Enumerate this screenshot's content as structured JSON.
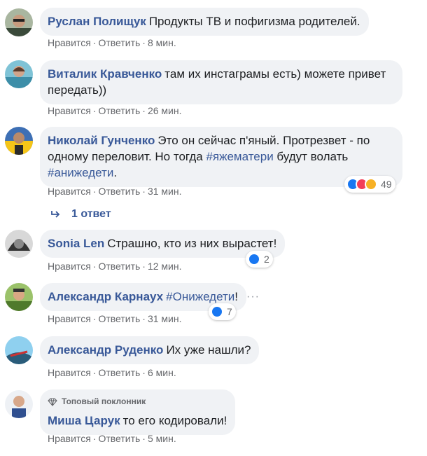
{
  "actions": {
    "like": "Нравится",
    "reply": "Ответить",
    "sep": "·"
  },
  "comments": [
    {
      "author": "Руслан Полищук",
      "text": "Продукты ТВ и пофигизма родителей.",
      "time": "8 мин."
    },
    {
      "author": "Виталик Кравченко",
      "text_line1": "там их инстаграмы есть) можете привет",
      "text_line2": "передать))",
      "time": "26 мин."
    },
    {
      "author": "Николай Гунченко",
      "text_line1": "Это он сейчас п'яный. Протрезвет - по",
      "text_line2_pre": "одному переловит. Но тогда ",
      "hashtag1": "#яжематери",
      "text_line2_post": " будут волать",
      "hashtag2": "#анижедети",
      "text_line3_post": ".",
      "time": "31 мин.",
      "reactions": "49",
      "replies_label": "1 ответ"
    },
    {
      "author": "Sonia Len",
      "text": "Страшно, кто из них вырастет!",
      "time": "12 мин.",
      "reactions": "2"
    },
    {
      "author": "Александр Карнаух",
      "hashtag": "#Онижедети",
      "text": "!",
      "time": "31 мин.",
      "reactions": "7",
      "more": "···"
    },
    {
      "author": "Александр Руденко",
      "text": "Их уже нашли?",
      "time": "6 мин."
    },
    {
      "badge": "Топовый поклонник",
      "author": "Миша Царук",
      "text": "то его кодировали!",
      "time": "5 мин."
    }
  ],
  "colors": {
    "link": "#385898",
    "bubble": "#f0f2f5",
    "meta": "#65676b",
    "like": "#1877f2",
    "love": "#f33e58",
    "haha": "#f7b125"
  },
  "icons": [
    "like-reaction-icon",
    "love-reaction-icon",
    "haha-reaction-icon",
    "reply-arrow-icon",
    "diamond-icon"
  ]
}
